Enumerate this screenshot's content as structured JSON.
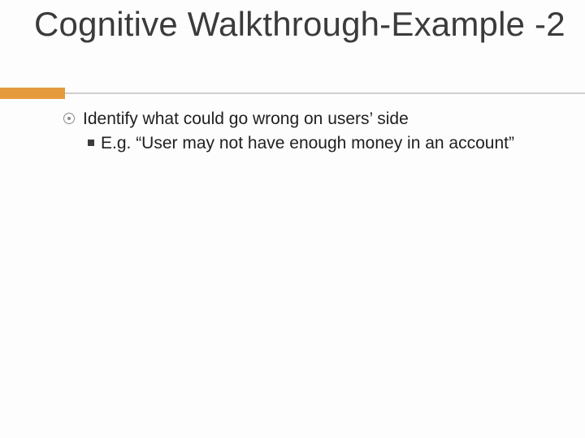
{
  "slide": {
    "title": "Cognitive Walkthrough-Example -2",
    "bullets": {
      "level1": "Identify what could go wrong on users’ side",
      "level2": "E.g. “User may not have enough money in an account”"
    }
  }
}
